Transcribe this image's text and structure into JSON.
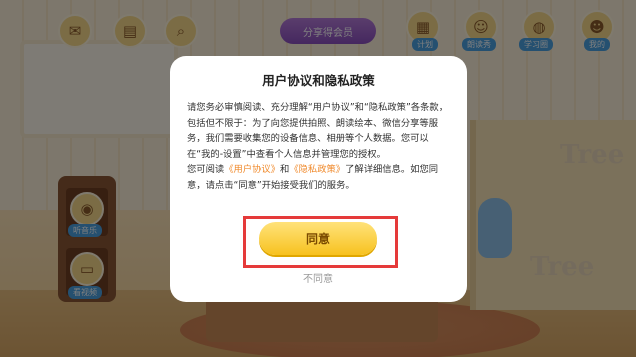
{
  "top_bar": {
    "left_icons": [
      {
        "icon": "envelope-icon"
      },
      {
        "icon": "book-icon"
      },
      {
        "icon": "search-icon"
      }
    ],
    "vip_banner": "分享得会员",
    "right_tabs": [
      {
        "icon": "calendar-icon",
        "label": "计划"
      },
      {
        "icon": "girl-avatar-icon",
        "label": "朗读秀"
      },
      {
        "icon": "globe-icon",
        "label": "学习圈"
      },
      {
        "icon": "boy-avatar-icon",
        "label": "我的"
      }
    ]
  },
  "shelf": {
    "items": [
      {
        "icon": "record-player-icon",
        "label": "听音乐"
      },
      {
        "icon": "tv-icon",
        "label": "看视频"
      }
    ]
  },
  "background": {
    "tree_text": "Tree",
    "tree_text_2": "Tree"
  },
  "dialog": {
    "title": "用户协议和隐私政策",
    "paragraph1": "请您务必审慎阅读、充分理解“用户协议”和“隐私政策”各条款，包括但不限于：为了向您提供拍照、朗读绘本、微信分享等服务，我们需要收集您的设备信息、相册等个人数据。您可以在“我的-设置”中查看个人信息并管理您的授权。",
    "p2_prefix": "您可阅读",
    "user_agreement_link": "《用户协议》",
    "p2_and": "和",
    "privacy_policy_link": "《隐私政策》",
    "p2_suffix": "了解详细信息。如您同意，请点击“同意”开始接受我们的服务。",
    "agree_label": "同意",
    "disagree_label": "不同意"
  },
  "colors": {
    "accent": "#f7c21f",
    "link": "#f08a2c",
    "highlight_border": "#e53a3a"
  }
}
